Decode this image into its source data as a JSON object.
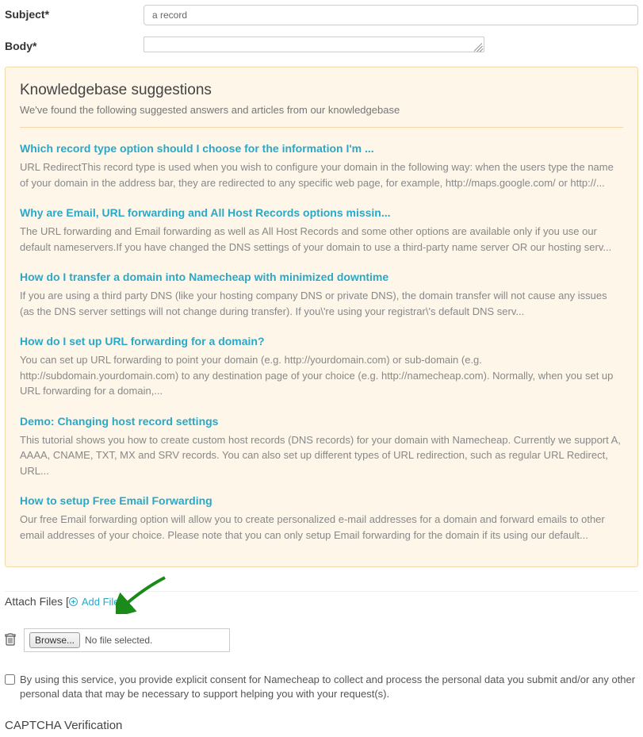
{
  "form": {
    "subject_label": "Subject",
    "subject_value": "a record",
    "body_label": "Body"
  },
  "kb": {
    "title": "Knowledgebase suggestions",
    "subtitle": "We've found the following suggested answers and articles from our knowledgebase",
    "items": [
      {
        "title": "Which record type option should I choose for the information I'm ...",
        "desc": "URL RedirectThis record type is used when you wish to configure your domain in the following way: when the users type the name of your domain in the address bar, they are redirected to any specific web page, for example, http://maps.google.com/ or http://..."
      },
      {
        "title": "Why are Email, URL forwarding and All Host Records options missin...",
        "desc": "The URL forwarding and Email forwarding as well as All Host Records and some other options are available only if you use our default nameservers.If you have changed the DNS settings of your domain to use a third-party name server OR our hosting serv..."
      },
      {
        "title": "How do I transfer a domain into Namecheap with minimized downtime",
        "desc": "If you are using a third party DNS (like your hosting company DNS or private DNS), the domain transfer will not cause any issues (as the DNS server settings will not change during transfer). If you\\'re using your registrar\\'s default DNS serv..."
      },
      {
        "title": "How do I set up URL forwarding for a domain?",
        "desc": "You can set up URL forwarding to point your domain (e.g. http://yourdomain.com) or sub-domain (e.g. http://subdomain.yourdomain.com) to any destination page of your choice (e.g. http://namecheap.com). Normally, when you set up URL forwarding for a domain,..."
      },
      {
        "title": "Demo: Changing host record settings",
        "desc": "This tutorial shows you how to create custom host records (DNS records) for your domain with Namecheap. Currently we support A, AAAA, CNAME, TXT, MX and SRV records. You can also set up different types of URL redirection, such as regular URL Redirect, URL..."
      },
      {
        "title": "How to setup Free Email Forwarding",
        "desc": "Our free Email forwarding option will allow you to create personalized e-mail addresses for a domain and forward emails to other email addresses of your choice. Please note that you can only setup Email forwarding for the domain if its using our default..."
      }
    ]
  },
  "attach": {
    "label": "Attach Files ",
    "add_file": "Add File",
    "browse": "Browse...",
    "no_file": "No file selected."
  },
  "consent": {
    "text": "By using this service, you provide explicit consent for Namecheap to collect and process the personal data you submit and/or any other personal data that may be necessary to support helping you with your request(s)."
  },
  "captcha": {
    "title": "CAPTCHA Verification"
  }
}
